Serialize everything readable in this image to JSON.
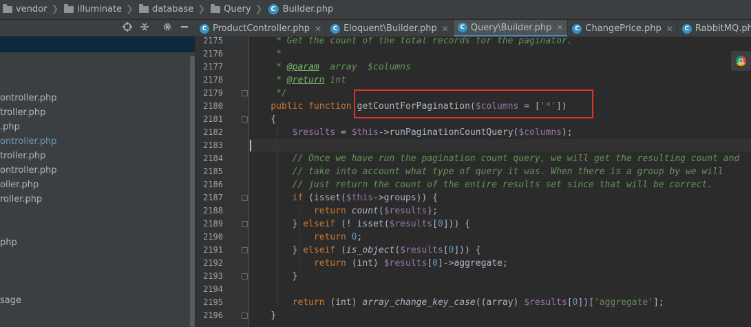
{
  "breadcrumb": [
    {
      "label": "vendor",
      "icon": "folder-icon"
    },
    {
      "label": "illuminate",
      "icon": "folder-icon"
    },
    {
      "label": "database",
      "icon": "folder-icon"
    },
    {
      "label": "Query",
      "icon": "folder-icon"
    },
    {
      "label": "Builder.php",
      "icon": "class-icon",
      "badge": "C"
    }
  ],
  "project": {
    "toolbar_icons": [
      "crosshair-icon",
      "collapse-icon",
      "gear-icon",
      "minimize-icon"
    ],
    "items": [
      "ontroller.php",
      "troller.php",
      ".php",
      "ontroller.php",
      "troller.php",
      "ontroller.php",
      "oller.php",
      "roller.php",
      "php",
      "sage"
    ],
    "active_index": 3
  },
  "tabs": [
    {
      "label": "ProductController.php",
      "badge": "C",
      "active": false
    },
    {
      "label": "Eloquent\\Builder.php",
      "badge": "C",
      "active": false
    },
    {
      "label": "Query\\Builder.php",
      "badge": "C",
      "active": true
    },
    {
      "label": "ChangePrice.php",
      "badge": "C",
      "active": false
    },
    {
      "label": "RabbitMQ.php",
      "badge": "C",
      "active": false
    }
  ],
  "colors": {
    "keyword": "#cc7832",
    "variable": "#9876aa",
    "string": "#6a8759",
    "number": "#6897bb",
    "comment": "#629755",
    "docTag": "#629755",
    "docTagName": "#77b767",
    "function": "#ffc66d",
    "plain": "#a9b7c6",
    "highlight_border": "#e0312c",
    "accent": "#4a88c7"
  },
  "code": {
    "line_numbers": [
      "2175",
      "2176",
      "2177",
      "2178",
      "2179",
      "2180",
      "2181",
      "2182",
      "2183",
      "2184",
      "2185",
      "2186",
      "2187",
      "2188",
      "2189",
      "2190",
      "2191",
      "2192",
      "2193",
      "2194",
      "2195",
      "2196"
    ],
    "lines": [
      [
        [
          "comment",
          "     * Get the count of the total records for the paginator."
        ]
      ],
      [
        [
          "comment",
          "     *"
        ]
      ],
      [
        [
          "comment",
          "     * "
        ],
        [
          "doctag",
          "@param"
        ],
        [
          "comment",
          "  array  $columns"
        ]
      ],
      [
        [
          "comment",
          "     * "
        ],
        [
          "doctag",
          "@return"
        ],
        [
          "comment",
          " int"
        ]
      ],
      [
        [
          "comment",
          "     */"
        ]
      ],
      [
        [
          "kw",
          "    public function "
        ],
        [
          "plain",
          "getCountForPagination("
        ],
        [
          "var",
          "$columns"
        ],
        [
          "plain",
          " = ["
        ],
        [
          "str",
          "'*'"
        ],
        [
          "plain",
          "])"
        ]
      ],
      [
        [
          "plain",
          "    {"
        ]
      ],
      [
        [
          "var",
          "        $results"
        ],
        [
          "plain",
          " = "
        ],
        [
          "var",
          "$this"
        ],
        [
          "plain",
          "->runPaginationCountQuery("
        ],
        [
          "var",
          "$columns"
        ],
        [
          "plain",
          ");"
        ]
      ],
      [
        [
          "plain",
          ""
        ]
      ],
      [
        [
          "comment",
          "        // Once we have run the pagination count query, we will get the resulting count and"
        ]
      ],
      [
        [
          "comment",
          "        // take into account what type of query it was. When there is a group by we will"
        ]
      ],
      [
        [
          "comment",
          "        // just return the count of the entire results set since that will be correct."
        ]
      ],
      [
        [
          "kw",
          "        if "
        ],
        [
          "plain",
          "(isset("
        ],
        [
          "var",
          "$this"
        ],
        [
          "plain",
          "->groups)) {"
        ]
      ],
      [
        [
          "kw",
          "            return "
        ],
        [
          "italic",
          "count"
        ],
        [
          "plain",
          "("
        ],
        [
          "var",
          "$results"
        ],
        [
          "plain",
          ");"
        ]
      ],
      [
        [
          "plain",
          "        } "
        ],
        [
          "kw",
          "elseif "
        ],
        [
          "plain",
          "(! isset("
        ],
        [
          "var",
          "$results"
        ],
        [
          "plain",
          "["
        ],
        [
          "num",
          "0"
        ],
        [
          "plain",
          "])) {"
        ]
      ],
      [
        [
          "kw",
          "            return "
        ],
        [
          "num",
          "0"
        ],
        [
          "plain",
          ";"
        ]
      ],
      [
        [
          "plain",
          "        } "
        ],
        [
          "kw",
          "elseif "
        ],
        [
          "plain",
          "("
        ],
        [
          "italic",
          "is_object"
        ],
        [
          "plain",
          "("
        ],
        [
          "var",
          "$results"
        ],
        [
          "plain",
          "["
        ],
        [
          "num",
          "0"
        ],
        [
          "plain",
          "])) {"
        ]
      ],
      [
        [
          "kw",
          "            return "
        ],
        [
          "plain",
          "(int) "
        ],
        [
          "var",
          "$results"
        ],
        [
          "plain",
          "["
        ],
        [
          "num",
          "0"
        ],
        [
          "plain",
          "]->aggregate;"
        ]
      ],
      [
        [
          "plain",
          "        }"
        ]
      ],
      [
        [
          "plain",
          ""
        ]
      ],
      [
        [
          "kw",
          "        return "
        ],
        [
          "plain",
          "(int) "
        ],
        [
          "italic",
          "array_change_key_case"
        ],
        [
          "plain",
          "((array) "
        ],
        [
          "var",
          "$results"
        ],
        [
          "plain",
          "["
        ],
        [
          "num",
          "0"
        ],
        [
          "plain",
          "])["
        ],
        [
          "str",
          "'aggregate'"
        ],
        [
          "plain",
          "];"
        ]
      ],
      [
        [
          "plain",
          "    }"
        ]
      ]
    ]
  }
}
